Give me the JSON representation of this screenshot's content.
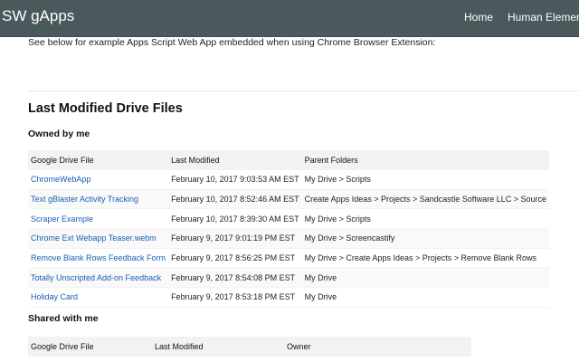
{
  "navbar": {
    "brand": "SW gApps",
    "links": [
      "Home",
      "Human Element"
    ]
  },
  "intro": "See below for example Apps Script Web App embedded when using Chrome Browser Extension:",
  "page_title": "Last Modified Drive Files",
  "owned": {
    "title": "Owned by me",
    "headers": [
      "Google Drive File",
      "Last Modified",
      "Parent Folders"
    ],
    "rows": [
      {
        "file": "ChromeWebApp",
        "modified": "February 10, 2017 9:03:53 AM EST",
        "folders": "My Drive > Scripts"
      },
      {
        "file": "Text gBlaster Activity Tracking",
        "modified": "February 10, 2017 8:52:46 AM EST",
        "folders": "Create Apps Ideas > Projects > Sandcastle Software LLC > Source"
      },
      {
        "file": "Scraper Example",
        "modified": "February 10, 2017 8:39:30 AM EST",
        "folders": "My Drive > Scripts"
      },
      {
        "file": "Chrome Ext Webapp Teaser.webm",
        "modified": "February 9, 2017 9:01:19 PM EST",
        "folders": "My Drive > Screencastify"
      },
      {
        "file": "Remove Blank Rows Feedback Form",
        "modified": "February 9, 2017 8:56:25 PM EST",
        "folders": "My Drive > Create Apps Ideas > Projects > Remove Blank Rows"
      },
      {
        "file": "Totally Unscripted Add-on Feedback",
        "modified": "February 9, 2017 8:54:08 PM EST",
        "folders": "My Drive"
      },
      {
        "file": "Holiday Card",
        "modified": "February 9, 2017 8:53:18 PM EST",
        "folders": "My Drive"
      }
    ]
  },
  "shared": {
    "title": "Shared with me",
    "headers": [
      "Google Drive File",
      "Last Modified",
      "Owner"
    ]
  }
}
